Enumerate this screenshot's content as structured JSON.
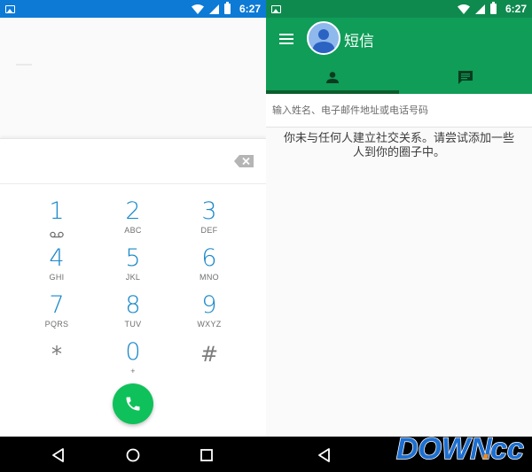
{
  "status_bar": {
    "left_time": "6:27",
    "right_time": "6:27"
  },
  "dialer": {
    "keys": [
      {
        "digit": "1",
        "letters": "voicemail-icon"
      },
      {
        "digit": "2",
        "letters": "ABC"
      },
      {
        "digit": "3",
        "letters": "DEF"
      },
      {
        "digit": "4",
        "letters": "GHI"
      },
      {
        "digit": "5",
        "letters": "JKL"
      },
      {
        "digit": "6",
        "letters": "MNO"
      },
      {
        "digit": "7",
        "letters": "PQRS"
      },
      {
        "digit": "8",
        "letters": "TUV"
      },
      {
        "digit": "9",
        "letters": "WXYZ"
      },
      {
        "digit": "*",
        "letters": ""
      },
      {
        "digit": "0",
        "letters": "+"
      },
      {
        "digit": "#",
        "letters": ""
      }
    ],
    "call_button_icon": "phone-icon",
    "backspace_icon": "backspace-icon",
    "accent_color": "#1a88c9",
    "call_color": "#0fc15a"
  },
  "messaging": {
    "title": "短信",
    "tabs": [
      {
        "icon": "person-icon",
        "selected": true
      },
      {
        "icon": "chat-icon",
        "selected": false
      }
    ],
    "search_placeholder": "输入姓名、电子邮件地址或电话号码",
    "empty_line1": "你未与任何人建立社交关系。请尝试添加一些",
    "empty_line2": "人到你的圈子中。",
    "header_color": "#0f9d58"
  },
  "nav_bar": {
    "buttons": [
      "back-icon",
      "home-icon",
      "recents-icon"
    ]
  },
  "watermark": {
    "text_main": "DOWN",
    "text_dot": ".",
    "text_suffix": "cc"
  }
}
